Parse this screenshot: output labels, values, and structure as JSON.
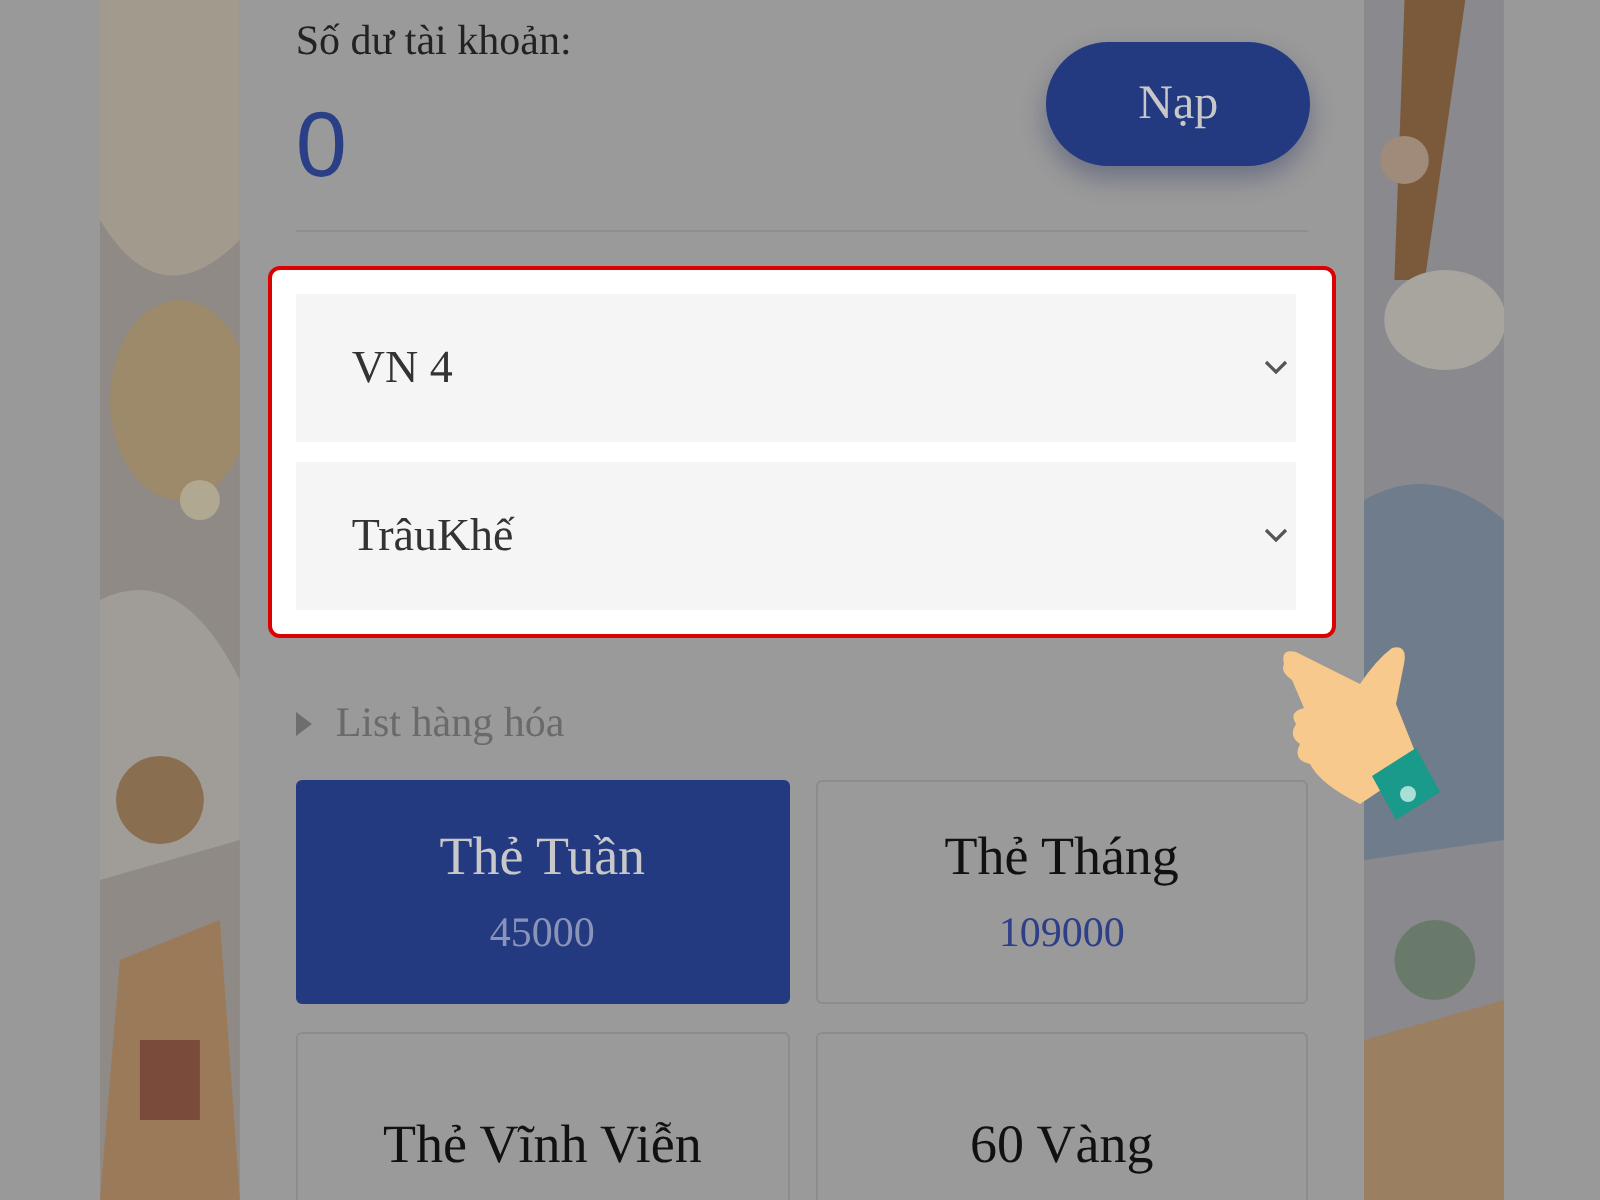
{
  "balance": {
    "label": "Số dư tài khoản:",
    "value": "0",
    "button": "Nạp"
  },
  "selects": [
    {
      "value": "VN 4"
    },
    {
      "value": "TrâuKhế"
    }
  ],
  "list_heading": "List hàng hóa",
  "products": [
    {
      "name": "Thẻ Tuần",
      "price": "45000",
      "selected": true
    },
    {
      "name": "Thẻ Tháng",
      "price": "109000",
      "selected": false
    },
    {
      "name": "Thẻ Vĩnh Viễn",
      "selected": false
    },
    {
      "name": "60 Vàng",
      "selected": false
    }
  ]
}
